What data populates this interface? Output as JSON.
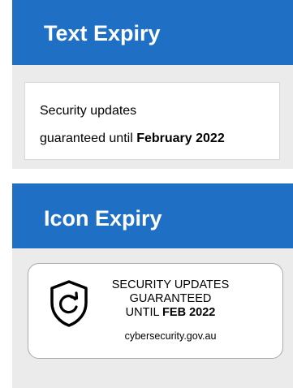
{
  "text_expiry": {
    "title": "Text Expiry",
    "line1": "Security updates",
    "line2_prefix": "guaranteed until ",
    "line2_date": "February 2022"
  },
  "icon_expiry": {
    "title": "Icon Expiry",
    "line1": "SECURITY UPDATES",
    "line2": "GUARANTEED",
    "line3_prefix": "UNTIL ",
    "line3_date": "FEB 2022",
    "url": "cybersecurity.gov.au",
    "icon": "shield-refresh-icon"
  },
  "colors": {
    "banner": "#1f6fc5",
    "panel": "#ebebeb"
  }
}
